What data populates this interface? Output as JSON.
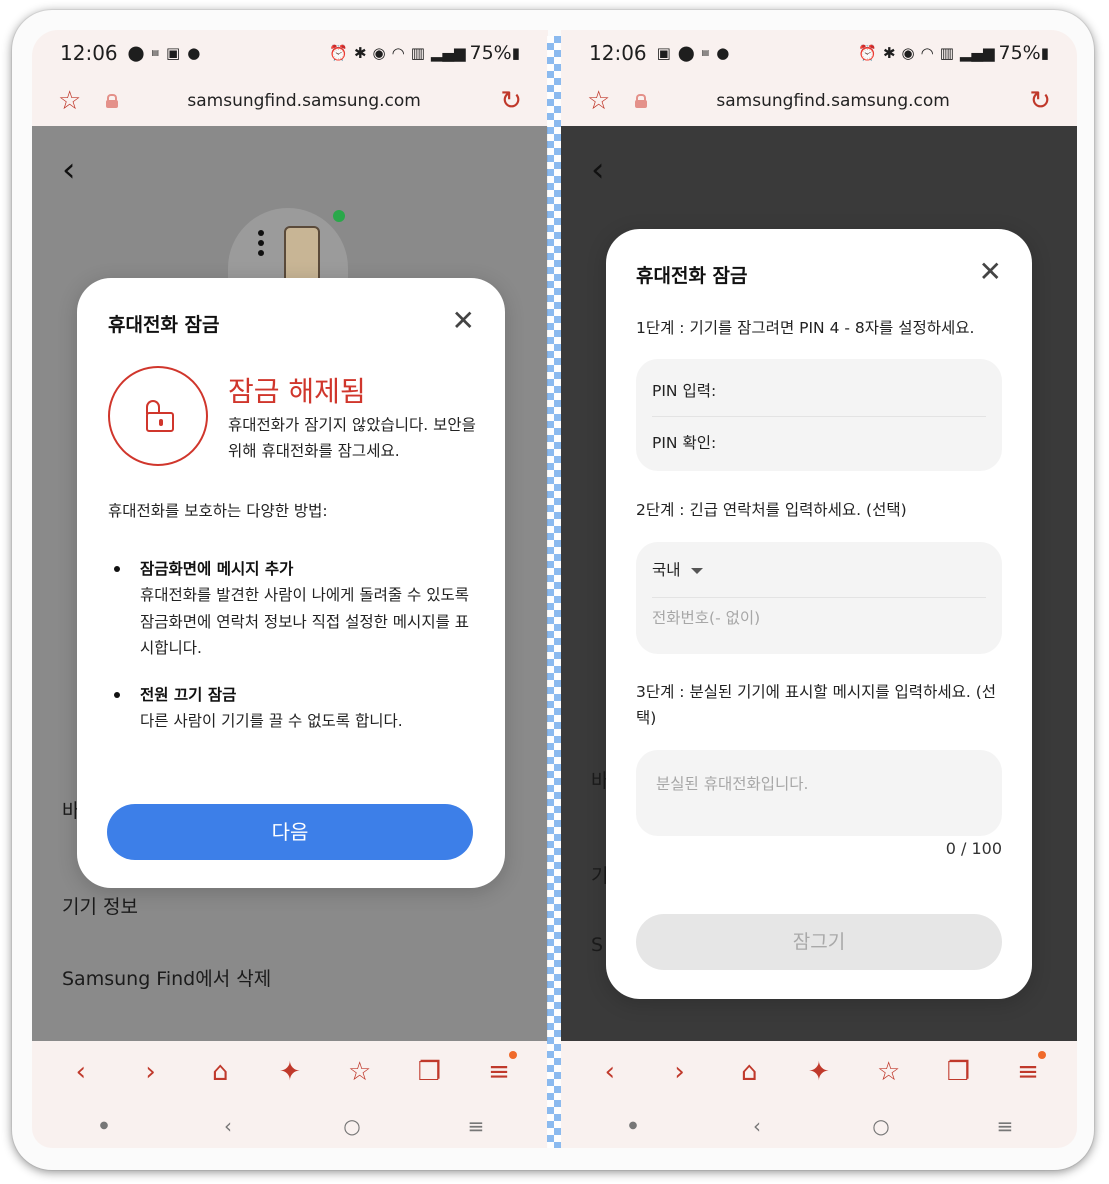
{
  "left": {
    "status": {
      "time": "12:06",
      "battery": "75%"
    },
    "browser": {
      "url": "samsungfind.samsung.com"
    },
    "background": {
      "partial_label": "바",
      "device_info": "기기 정보",
      "delete_label": "Samsung Find에서 삭제"
    },
    "dialog": {
      "title": "휴대전화 잠금",
      "unlock_title": "잠금 해제됨",
      "unlock_desc": "휴대전화가 잠기지 않았습니다. 보안을 위해 휴대전화를 잠그세요.",
      "methods_title": "휴대전화를 보호하는 다양한 방법:",
      "methods": [
        {
          "title": "잠금화면에 메시지 추가",
          "desc": "휴대전화를 발견한 사람이 나에게 돌려줄 수 있도록 잠금화면에 연락처 정보나 직접 설정한 메시지를 표시합니다."
        },
        {
          "title": "전원 끄기 잠금",
          "desc": "다른 사람이 기기를 끌 수 없도록 합니다."
        }
      ],
      "next_button": "다음"
    }
  },
  "right": {
    "status": {
      "time": "12:06",
      "battery": "75%"
    },
    "browser": {
      "url": "samsungfind.samsung.com"
    },
    "background": {
      "partial_1": "바",
      "partial_2": "기",
      "partial_3": "S"
    },
    "dialog": {
      "title": "휴대전화 잠금",
      "step1": "1단계 : 기기를 잠그려면 PIN 4 - 8자를 설정하세요.",
      "pin_input": "PIN 입력:",
      "pin_confirm": "PIN 확인:",
      "step2": "2단계 : 긴급 연락처를 입력하세요. (선택)",
      "country": "국내",
      "phone_placeholder": "전화번호(- 없이)",
      "step3": "3단계 : 분실된 기기에 표시할 메시지를 입력하세요. (선택)",
      "message_placeholder": "분실된 휴대전화입니다.",
      "counter": "0 / 100",
      "lock_button": "잠그기"
    }
  },
  "colors": {
    "accent_red": "#c0392b",
    "primary_blue": "#3d7fe8",
    "unlock_red": "#d0362c"
  }
}
